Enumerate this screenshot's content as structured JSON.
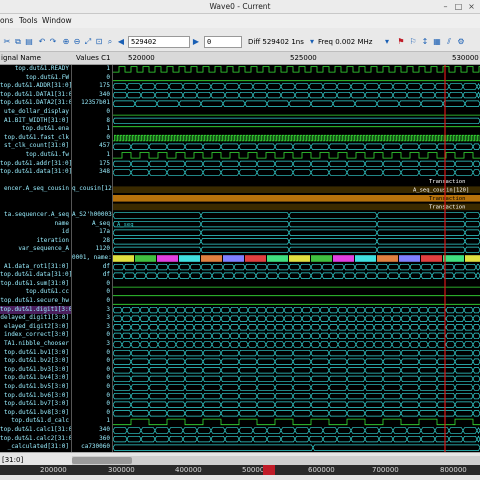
{
  "window": {
    "title": "Wave0 - Current",
    "min_icon": "minimize-icon",
    "max_icon": "maximize-icon",
    "close_icon": "close-icon"
  },
  "menu": [
    "ons",
    "Tools",
    "Window"
  ],
  "toolbar": {
    "time_value": "529402",
    "offset_value": "0",
    "diff_label": "Diff 529402 1ns",
    "freq_label": "Freq 0.002 MHz",
    "icons": [
      "cut-icon",
      "copy-icon",
      "paste-icon",
      "undo-icon",
      "redo-icon",
      "zoom-in-icon",
      "zoom-out-icon",
      "zoom-fit-icon",
      "zoom-area-icon",
      "search-icon",
      "prev-edge-icon",
      "next-edge-icon",
      "marker-flag-icon",
      "bookmark-icon",
      "settings-icon"
    ]
  },
  "header": {
    "signal_name": "ignal Name",
    "values": "Values C1",
    "ticks": [
      "520000",
      "525000",
      "530000"
    ]
  },
  "signals": [
    {
      "name": "top.dut&1.READY",
      "value": "1"
    },
    {
      "name": "top.dut&1.FW",
      "value": "0"
    },
    {
      "name": "top.dut&1.ADDR[31:0]",
      "value": "175"
    },
    {
      "name": "top.dut&1.DATA1[31:0]",
      "value": "340"
    },
    {
      "name": "top.dut&1.DATA2[31:0]",
      "value": "12357b01"
    },
    {
      "name": "ute_dollar_display",
      "value": "0"
    },
    {
      "name": "A1.BIT_WIDTH[31:0]",
      "value": "8"
    },
    {
      "name": "top.dut&1.ena",
      "value": "1"
    },
    {
      "name": "top.dut&1.fast_clk",
      "value": "0"
    },
    {
      "name": "st_clk_count[31:0]",
      "value": "457"
    },
    {
      "name": "top.dut&1.fw",
      "value": "1"
    },
    {
      "name": "top.dut&1.addr[31:0]",
      "value": "175"
    },
    {
      "name": "top.dut&1.data[31:0]",
      "value": "348"
    },
    {
      "name": "",
      "value": ""
    },
    {
      "name": "encer.A_seq_cousin",
      "value": "q_cousin[120]"
    },
    {
      "name": "",
      "value": ""
    },
    {
      "name": "",
      "value": ""
    },
    {
      "name": "ta.sequencer.A_seq",
      "value": "A_S2'h00003120"
    },
    {
      "name": "name",
      "value": "A_seq"
    },
    {
      "name": "id",
      "value": "17a"
    },
    {
      "name": "iteration",
      "value": "28"
    },
    {
      "name": "var_sequence_A",
      "value": "1120"
    },
    {
      "name": "",
      "value": "0001, name:t1"
    },
    {
      "name": "A1.data_rot1[31:0]",
      "value": "df"
    },
    {
      "name": "top.dut&1.data[31:0]",
      "value": "df"
    },
    {
      "name": "top.dut&1.sum[31:0]",
      "value": "0"
    },
    {
      "name": "top.dut&1.cc",
      "value": "0"
    },
    {
      "name": "top.dut&1.secure_hw",
      "value": "0"
    },
    {
      "name": "top.dut&1.digit1[3:0]",
      "value": "3"
    },
    {
      "name": "delayed_digit1[3:0]",
      "value": "3"
    },
    {
      "name": "elayed_digit2[3:0]",
      "value": "3"
    },
    {
      "name": "index_correct[3:0]",
      "value": "0"
    },
    {
      "name": "TA1.nibble_chooser",
      "value": "3"
    },
    {
      "name": "top.dut&1.bv1[3:0]",
      "value": "0"
    },
    {
      "name": "top.dut&1.bv2[3:0]",
      "value": "0"
    },
    {
      "name": "top.dut&1.bv3[3:0]",
      "value": "0"
    },
    {
      "name": "top.dut&1.bv4[3:0]",
      "value": "0"
    },
    {
      "name": "top.dut&1.bv5[3:0]",
      "value": "0"
    },
    {
      "name": "top.dut&1.bv6[3:0]",
      "value": "0"
    },
    {
      "name": "top.dut&1.bv7[3:0]",
      "value": "0"
    },
    {
      "name": "top.dut&1.bv8[3:0]",
      "value": "0"
    },
    {
      "name": "top.dut&1.d_calc",
      "value": "1"
    },
    {
      "name": "top.dut&1.calc1[31:0]",
      "value": "340"
    },
    {
      "name": "top.dut&1.calc2[31:0]",
      "value": "360"
    },
    {
      "name": "_calculated[31:0]",
      "value": "ca730060"
    }
  ],
  "wave_annotations": {
    "transaction_1": "Transaction",
    "transaction_2": "Transaction",
    "transaction_3": "Transaction",
    "seq_name": "A_seq",
    "cousin_label": "A_seq_cousin[120]"
  },
  "bottom": {
    "bus_label": "[31:0]",
    "overview_ticks": [
      "200000",
      "300000",
      "400000",
      "500000",
      "600000",
      "700000",
      "800000"
    ]
  },
  "colors": {
    "cursor": "#d81818",
    "wave_green": "#37e237",
    "wave_cyan": "#35d6d6",
    "background": "#000000"
  }
}
